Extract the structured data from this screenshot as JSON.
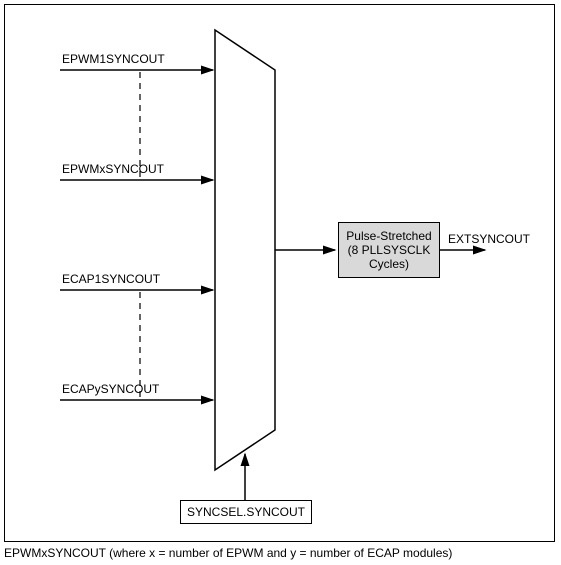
{
  "inputs": {
    "i0": "EPWM1SYNCOUT",
    "i1": "EPWMxSYNCOUT",
    "i2": "ECAP1SYNCOUT",
    "i3": "ECAPySYNCOUT"
  },
  "block": {
    "line1": "Pulse-Stretched",
    "line2": "(8 PLLSYSCLK",
    "line3": "Cycles)"
  },
  "output": "EXTSYNCOUT",
  "select": "SYNCSEL.SYNCOUT",
  "footnote": "EPWMxSYNCOUT (where x = number of EPWM and y = number of ECAP modules)"
}
